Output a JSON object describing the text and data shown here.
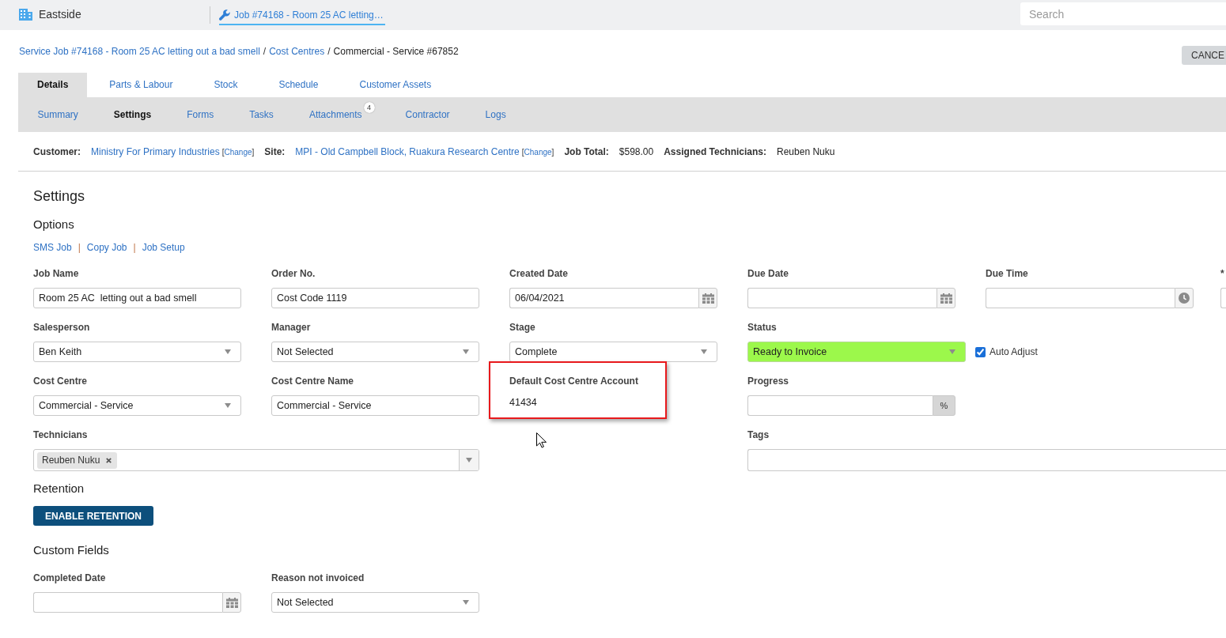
{
  "top_bar": {
    "location": "Eastside",
    "open_tab": {
      "label": "Job #74168 - Room 25 AC letting…",
      "selected": true
    },
    "search": {
      "placeholder": "Search"
    }
  },
  "breadcrumb": [
    {
      "kind": "link",
      "text": "Service Job #74168 - Room 25 AC letting out a bad smell"
    },
    {
      "kind": "separator",
      "text": "/"
    },
    {
      "kind": "link",
      "text": "Cost Centres"
    },
    {
      "kind": "separator",
      "text": "/"
    },
    {
      "kind": "current",
      "text": "Commercial - Service #67852"
    }
  ],
  "cancel_button": "CANCE",
  "tabs": [
    {
      "label": "Details",
      "selected": true
    },
    {
      "label": "Parts & Labour",
      "selected": false
    },
    {
      "label": "Stock",
      "selected": false
    },
    {
      "label": "Schedule",
      "selected": false
    },
    {
      "label": "Customer Assets",
      "selected": false
    }
  ],
  "subtabs": [
    {
      "label": "Summary",
      "selected": false
    },
    {
      "label": "Settings",
      "selected": true
    },
    {
      "label": "Forms",
      "selected": false
    },
    {
      "label": "Tasks",
      "selected": false
    },
    {
      "label": "Attachments",
      "selected": false,
      "badge": "4"
    },
    {
      "label": "Contractor",
      "selected": false
    },
    {
      "label": "Logs",
      "selected": false
    }
  ],
  "job_info": [
    {
      "kind": "link",
      "label": "Customer:",
      "value": "Ministry For Primary Industries",
      "change": {
        "open": "[",
        "label": "Change",
        "close": "]"
      }
    },
    {
      "kind": "link",
      "label": "Site:",
      "value": "MPI - Old Campbell Block, Ruakura Research Centre",
      "change": {
        "open": "[",
        "label": "Change",
        "close": "]"
      }
    },
    {
      "kind": "text",
      "label": "Job Total:",
      "value": "$598.00"
    },
    {
      "kind": "text",
      "label": "Assigned Technicians:",
      "value": "Reuben Nuku"
    }
  ],
  "settings": {
    "title": "Settings",
    "options_title": "Options",
    "options": [
      {
        "kind": "link",
        "text": "SMS Job"
      },
      {
        "kind": "separator",
        "text": "|"
      },
      {
        "kind": "link",
        "text": "Copy Job"
      },
      {
        "kind": "separator",
        "text": "|"
      },
      {
        "kind": "link",
        "text": "Job Setup"
      }
    ]
  },
  "form": {
    "rows": [
      [
        {
          "kind": "text",
          "label": "Job Name",
          "value": "Room 25 AC  letting out a bad smell"
        },
        {
          "kind": "text",
          "label": "Order No.",
          "value": "Cost Code 1119"
        },
        {
          "kind": "date",
          "label": "Created Date",
          "value": "06/04/2021"
        },
        {
          "kind": "date",
          "label": "Due Date"
        },
        {
          "kind": "time",
          "label": "Due Time"
        },
        {
          "kind": "text",
          "label": "*"
        }
      ],
      [
        {
          "kind": "select",
          "label": "Salesperson",
          "value": "Ben Keith"
        },
        {
          "kind": "select",
          "label": "Manager",
          "value": "Not Selected"
        },
        {
          "kind": "select",
          "label": "Stage",
          "value": "Complete"
        },
        {
          "kind": "status",
          "label": "Status",
          "value": "Ready to Invoice",
          "color": "#9cf84b",
          "auto_adjust": {
            "label": "Auto Adjust",
            "checked": true
          }
        }
      ],
      [
        {
          "kind": "select",
          "label": "Cost Centre",
          "value": "Commercial - Service"
        },
        {
          "kind": "text",
          "label": "Cost Centre Name",
          "value": "Commercial - Service"
        },
        {
          "kind": "static",
          "label": "Default Cost Centre Account",
          "value": "41434",
          "highlighted": true
        },
        {
          "kind": "percent",
          "label": "Progress",
          "suffix": "%"
        }
      ],
      [
        {
          "kind": "multiselect",
          "label": "Technicians",
          "values": [
            "Reuben Nuku"
          ]
        },
        "",
        "",
        {
          "kind": "tags",
          "label": "Tags"
        }
      ]
    ]
  },
  "retention": {
    "title": "Retention",
    "button": "ENABLE RETENTION"
  },
  "custom_fields": {
    "title": "Custom Fields",
    "fields": [
      {
        "kind": "date",
        "label": "Completed Date"
      },
      {
        "kind": "select",
        "label": "Reason not invoiced",
        "value": "Not Selected"
      }
    ]
  }
}
